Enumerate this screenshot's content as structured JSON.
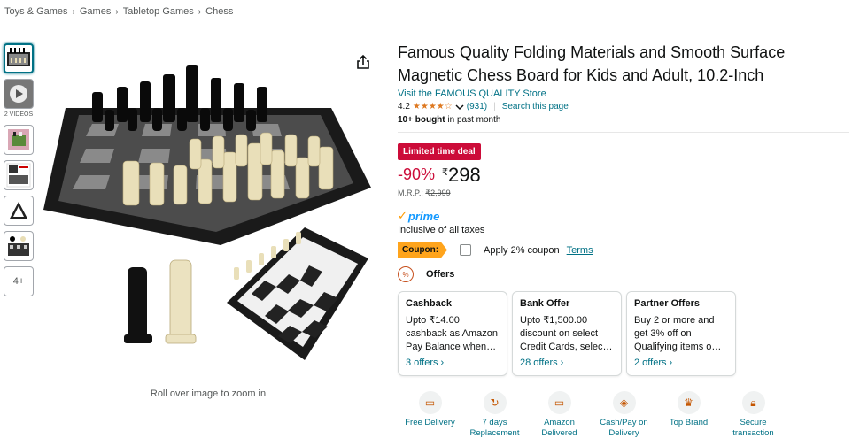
{
  "breadcrumb": [
    "Toys & Games",
    "Games",
    "Tabletop Games",
    "Chess"
  ],
  "thumbnails": {
    "video_label": "2 VIDEOS",
    "more_label": "4+"
  },
  "image": {
    "zoom_hint": "Roll over image to zoom in"
  },
  "product": {
    "title": "Famous Quality Folding Materials and Smooth Surface Magnetic Chess Board for Kids and Adult, 10.2-Inch",
    "store_link": "Visit the FAMOUS QUALITY Store",
    "rating": "4.2",
    "stars": "★★★★☆",
    "rating_count": "(931)",
    "search_page": "Search this page",
    "bought_bold": "10+ bought",
    "bought_rest": " in past month"
  },
  "pricing": {
    "deal_badge": "Limited time deal",
    "discount": "-90%",
    "currency": "₹",
    "price": "298",
    "mrp_label": "M.R.P.: ",
    "mrp_value": "₹2,999",
    "prime": "prime",
    "taxes": "Inclusive of all taxes"
  },
  "coupon": {
    "tag": "Coupon:",
    "text": "Apply 2% coupon",
    "terms": "Terms"
  },
  "offers": {
    "title": "Offers",
    "cards": [
      {
        "title": "Cashback",
        "body": "Upto ₹14.00 cashback as Amazon Pay Balance when…",
        "link": "3 offers ›"
      },
      {
        "title": "Bank Offer",
        "body": "Upto ₹1,500.00 discount on select Credit Cards, selec…",
        "link": "28 offers ›"
      },
      {
        "title": "Partner Offers",
        "body": "Buy 2 or more and get 3% off on Qualifying items o…",
        "link": "2 offers ›"
      }
    ]
  },
  "features": [
    {
      "label": "Free Delivery",
      "icon": "truck-icon"
    },
    {
      "label": "7 days Replacement",
      "icon": "replacement-icon"
    },
    {
      "label": "Amazon Delivered",
      "icon": "delivery-van-icon"
    },
    {
      "label": "Cash/Pay on Delivery",
      "icon": "cash-icon"
    },
    {
      "label": "Top Brand",
      "icon": "trophy-icon"
    },
    {
      "label": "Secure transaction",
      "icon": "lock-icon"
    }
  ],
  "colors": {
    "link": "#007185",
    "deal": "#cc0c39",
    "stars": "#de7921",
    "coupon": "#ffa41c",
    "prime": "#1399ff"
  }
}
